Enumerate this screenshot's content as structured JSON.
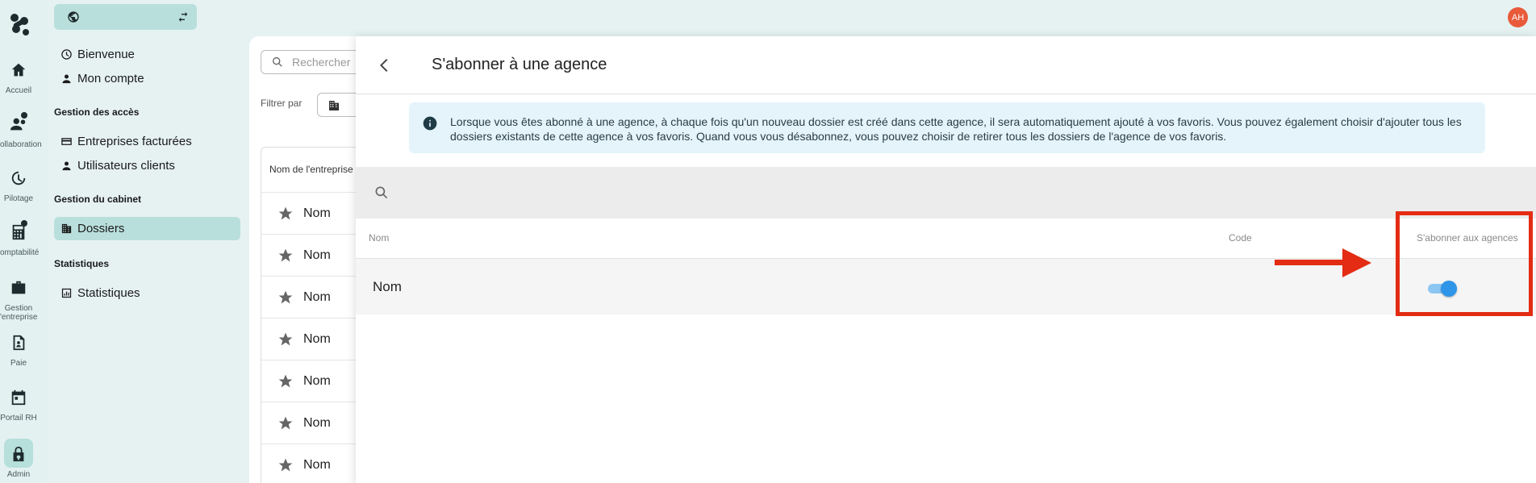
{
  "rail": {
    "items": [
      {
        "label": "Accueil",
        "icon": "home-icon"
      },
      {
        "label": "ollaboration",
        "icon": "collaboration-icon"
      },
      {
        "label": "Pilotage",
        "icon": "gauge-icon"
      },
      {
        "label": "omptabilité",
        "icon": "calculator-icon"
      },
      {
        "label": "Gestion",
        "label2": "'entreprise",
        "icon": "briefcase-icon"
      },
      {
        "label": "Paie",
        "icon": "payslip-icon"
      },
      {
        "label": "Portail RH",
        "icon": "calendar-icon"
      },
      {
        "label": "Admin",
        "icon": "lock-icon"
      }
    ]
  },
  "nav": {
    "items": [
      {
        "label": "Bienvenue"
      },
      {
        "label": "Mon compte"
      }
    ],
    "sections": [
      {
        "title": "Gestion des accès",
        "items": [
          {
            "label": "Entreprises facturées"
          },
          {
            "label": "Utilisateurs clients"
          }
        ]
      },
      {
        "title": "Gestion du cabinet",
        "items": [
          {
            "label": "Dossiers"
          }
        ]
      },
      {
        "title": "Statistiques",
        "items": [
          {
            "label": "Statistiques"
          }
        ]
      }
    ]
  },
  "background": {
    "search_placeholder": "Rechercher",
    "filter_label": "Filtrer par",
    "column_header": "Nom de l'entreprise",
    "rows": [
      "Nom",
      "Nom",
      "Nom",
      "Nom",
      "Nom",
      "Nom",
      "Nom"
    ]
  },
  "panel": {
    "title": "S'abonner à une agence",
    "info_text": "Lorsque vous êtes abonné à une agence, à chaque fois qu'un nouveau dossier est créé dans cette agence, il sera automatiquement ajouté à vos favoris. Vous pouvez également choisir d'ajouter tous les dossiers existants de cette agence à vos favoris. Quand vous vous désabonnez, vous pouvez choisir de retirer tous les dossiers de l'agence de vos favoris.",
    "search_value": "",
    "columns": {
      "name": "Nom",
      "code": "Code",
      "subscribe": "S'abonner aux agences"
    },
    "rows": [
      {
        "name": "Nom",
        "code": "",
        "subscribed": true
      }
    ]
  },
  "user": {
    "initials": "AH"
  },
  "colors": {
    "accent": "#b9dfdc",
    "toggle": "#2f95e8",
    "annotation": "#e32c13"
  }
}
